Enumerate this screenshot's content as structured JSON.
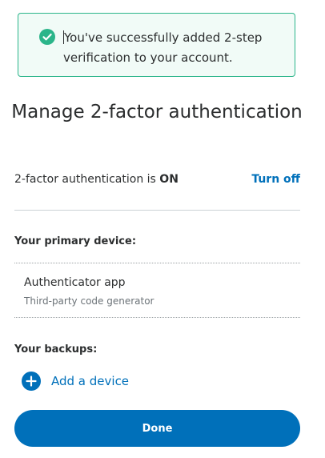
{
  "alert": {
    "icon": "check-circle-icon",
    "line1": "You've successfully added 2-step",
    "line2": "verification to your account.",
    "color": "#2bb58a"
  },
  "title": "Manage 2-factor authentication",
  "status": {
    "text": "2-factor authentication is ",
    "value": "ON",
    "action": "Turn off"
  },
  "primary": {
    "label": "Your primary device:",
    "device_name": "Authenticator app",
    "device_sub": "Third-party code generator"
  },
  "backups": {
    "label": "Your backups:",
    "add_icon": "plus-circle-icon",
    "add_label": "Add a device"
  },
  "done_label": "Done",
  "colors": {
    "accent": "#0070ba",
    "success": "#2bb58a",
    "text": "#2c2e2f"
  }
}
